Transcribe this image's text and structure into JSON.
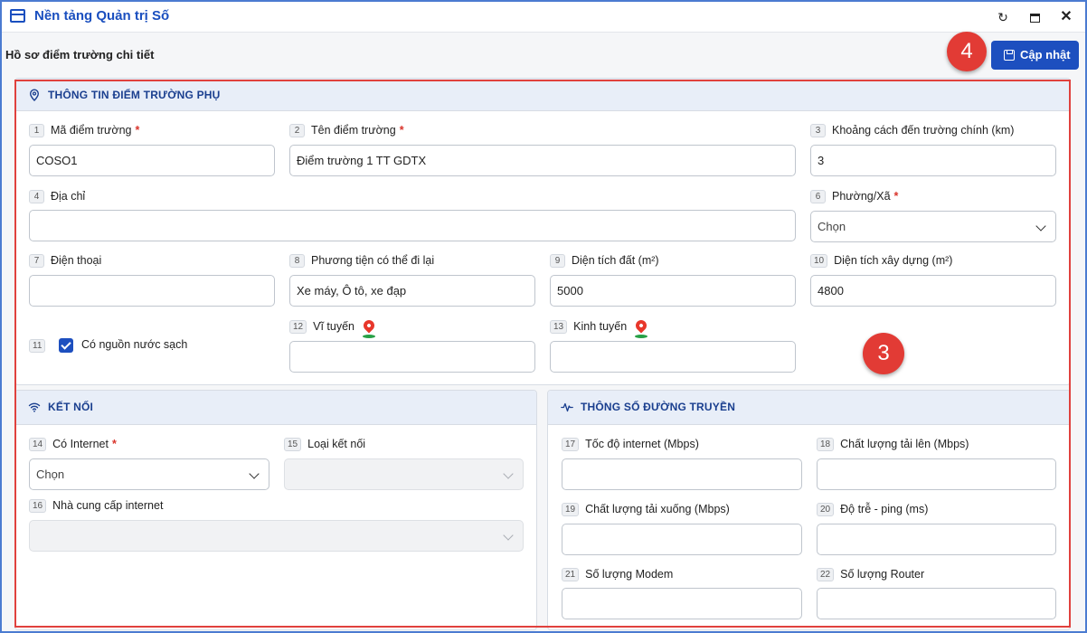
{
  "app": {
    "title": "Nền tảng Quản trị Số"
  },
  "page": {
    "title": "Hồ sơ điểm trường chi tiết",
    "update_label": "Cập nhật"
  },
  "markers": {
    "update": "4",
    "section": "3"
  },
  "sections": {
    "sub_school": "THÔNG TIN ĐIỂM TRƯỜNG PHỤ",
    "connection": "KẾT NỐI",
    "transmission": "THÔNG SỐ ĐƯỜNG TRUYỀN"
  },
  "fields": {
    "f1": {
      "num": "1",
      "label": "Mã điểm trường",
      "value": "COSO1"
    },
    "f2": {
      "num": "2",
      "label": "Tên điểm trường",
      "value": "Điểm trường 1 TT GDTX"
    },
    "f3": {
      "num": "3",
      "label": "Khoảng cách đến trường chính (km)",
      "value": "3"
    },
    "f4": {
      "num": "4",
      "label": "Địa chỉ",
      "value": ""
    },
    "f6": {
      "num": "6",
      "label": "Phường/Xã",
      "value": "Chọn"
    },
    "f7": {
      "num": "7",
      "label": "Điện thoại",
      "value": ""
    },
    "f8": {
      "num": "8",
      "label": "Phương tiện có thể đi lại",
      "value": "Xe máy, Ô tô, xe đạp"
    },
    "f9": {
      "num": "9",
      "label": "Diện tích đất (m²)",
      "value": "5000"
    },
    "f10": {
      "num": "10",
      "label": "Diện tích xây dựng (m²)",
      "value": "4800"
    },
    "f11": {
      "num": "11",
      "label": "Có nguồn nước sạch",
      "checked": true
    },
    "f12": {
      "num": "12",
      "label": "Vĩ tuyến",
      "value": ""
    },
    "f13": {
      "num": "13",
      "label": "Kinh tuyến",
      "value": ""
    },
    "f14": {
      "num": "14",
      "label": "Có Internet",
      "value": "Chọn"
    },
    "f15": {
      "num": "15",
      "label": "Loại kết nối",
      "value": ""
    },
    "f16": {
      "num": "16",
      "label": "Nhà cung cấp internet",
      "value": ""
    },
    "f17": {
      "num": "17",
      "label": "Tốc độ internet (Mbps)",
      "value": ""
    },
    "f18": {
      "num": "18",
      "label": "Chất lượng tải lên (Mbps)",
      "value": ""
    },
    "f19": {
      "num": "19",
      "label": "Chất lượng tải xuống (Mbps)",
      "value": ""
    },
    "f20": {
      "num": "20",
      "label": "Độ trễ - ping (ms)",
      "value": ""
    },
    "f21": {
      "num": "21",
      "label": "Số lượng Modem",
      "value": ""
    },
    "f22": {
      "num": "22",
      "label": "Số lượng Router",
      "value": ""
    }
  },
  "colors": {
    "accent": "#1d4fbf",
    "marker": "#e23b35",
    "highlight_frame": "#e0413d",
    "section_head": "#e8eef8"
  }
}
